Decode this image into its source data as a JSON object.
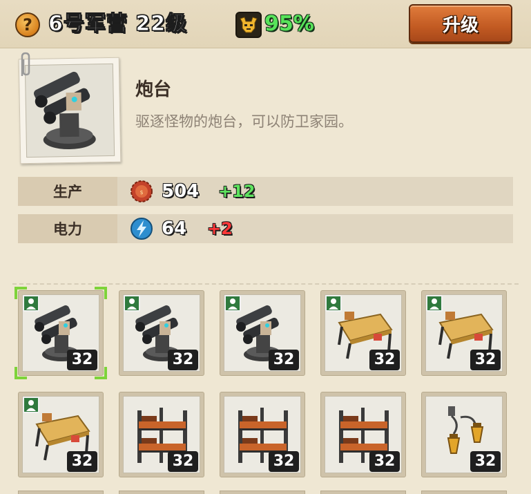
{
  "header": {
    "help_label": "?",
    "camp_title": "6号军营 22级",
    "morale_icon": "horned-skull-icon",
    "morale_value": "95%",
    "upgrade_label": "升级"
  },
  "building": {
    "name": "炮台",
    "description": "驱逐怪物的炮台，可以防卫家园。",
    "image_icon": "turret-icon"
  },
  "stats": [
    {
      "label": "生产",
      "icon": "bottle-cap-icon",
      "value": "504",
      "delta": "+12",
      "delta_color": "#5ee35e"
    },
    {
      "label": "电力",
      "icon": "lightning-icon",
      "value": "64",
      "delta": "+2",
      "delta_color": "#ff3838"
    }
  ],
  "slots": [
    {
      "type": "turret",
      "level": "32",
      "has_worker": true,
      "selected": true
    },
    {
      "type": "turret",
      "level": "32",
      "has_worker": true,
      "selected": false
    },
    {
      "type": "turret",
      "level": "32",
      "has_worker": true,
      "selected": false
    },
    {
      "type": "workbench",
      "level": "32",
      "has_worker": true,
      "selected": false
    },
    {
      "type": "workbench",
      "level": "32",
      "has_worker": true,
      "selected": false
    },
    {
      "type": "workbench",
      "level": "32",
      "has_worker": true,
      "selected": false
    },
    {
      "type": "bunk-bed",
      "level": "32",
      "has_worker": false,
      "selected": false
    },
    {
      "type": "bunk-bed",
      "level": "32",
      "has_worker": false,
      "selected": false
    },
    {
      "type": "bunk-bed",
      "level": "32",
      "has_worker": false,
      "selected": false
    },
    {
      "type": "lantern",
      "level": "32",
      "has_worker": false,
      "selected": false
    }
  ]
}
